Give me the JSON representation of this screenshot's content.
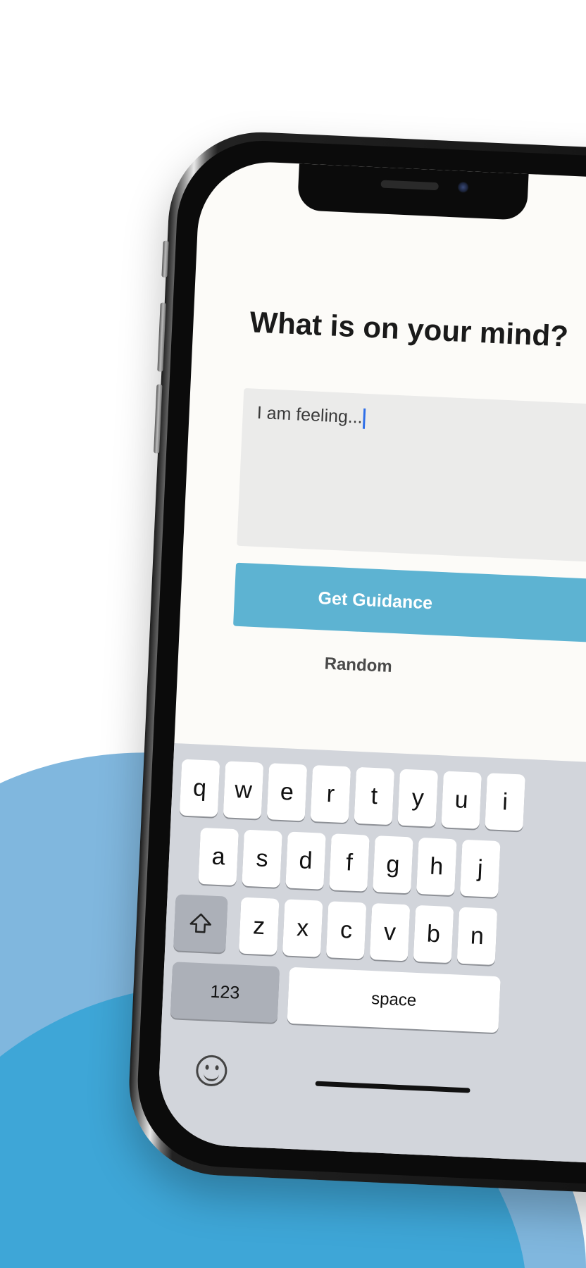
{
  "colors": {
    "background": "#ffffff",
    "wave_light": "#80b7de",
    "wave_dark": "#3ea6d7",
    "screen": "#fcfbf8",
    "input_background": "#ebebea",
    "button": "#5db3d2",
    "cursor": "#2f6fe8",
    "keyboard": "#d2d5db"
  },
  "screen": {
    "title": "What is on your mind?",
    "input": {
      "value": "I am feeling..."
    },
    "guidance_button_label": "Get Guidance",
    "random_button_label": "Random"
  },
  "keyboard": {
    "row1": [
      "q",
      "w",
      "e",
      "r",
      "t",
      "y",
      "u",
      "i"
    ],
    "row2": [
      "a",
      "s",
      "d",
      "f",
      "g",
      "h",
      "j"
    ],
    "row3": [
      "z",
      "x",
      "c",
      "v",
      "b",
      "n"
    ],
    "shift_icon": "shift-arrow-icon",
    "numbers_label": "123",
    "space_label": "space",
    "emoji_icon": "emoji-smile-icon"
  }
}
